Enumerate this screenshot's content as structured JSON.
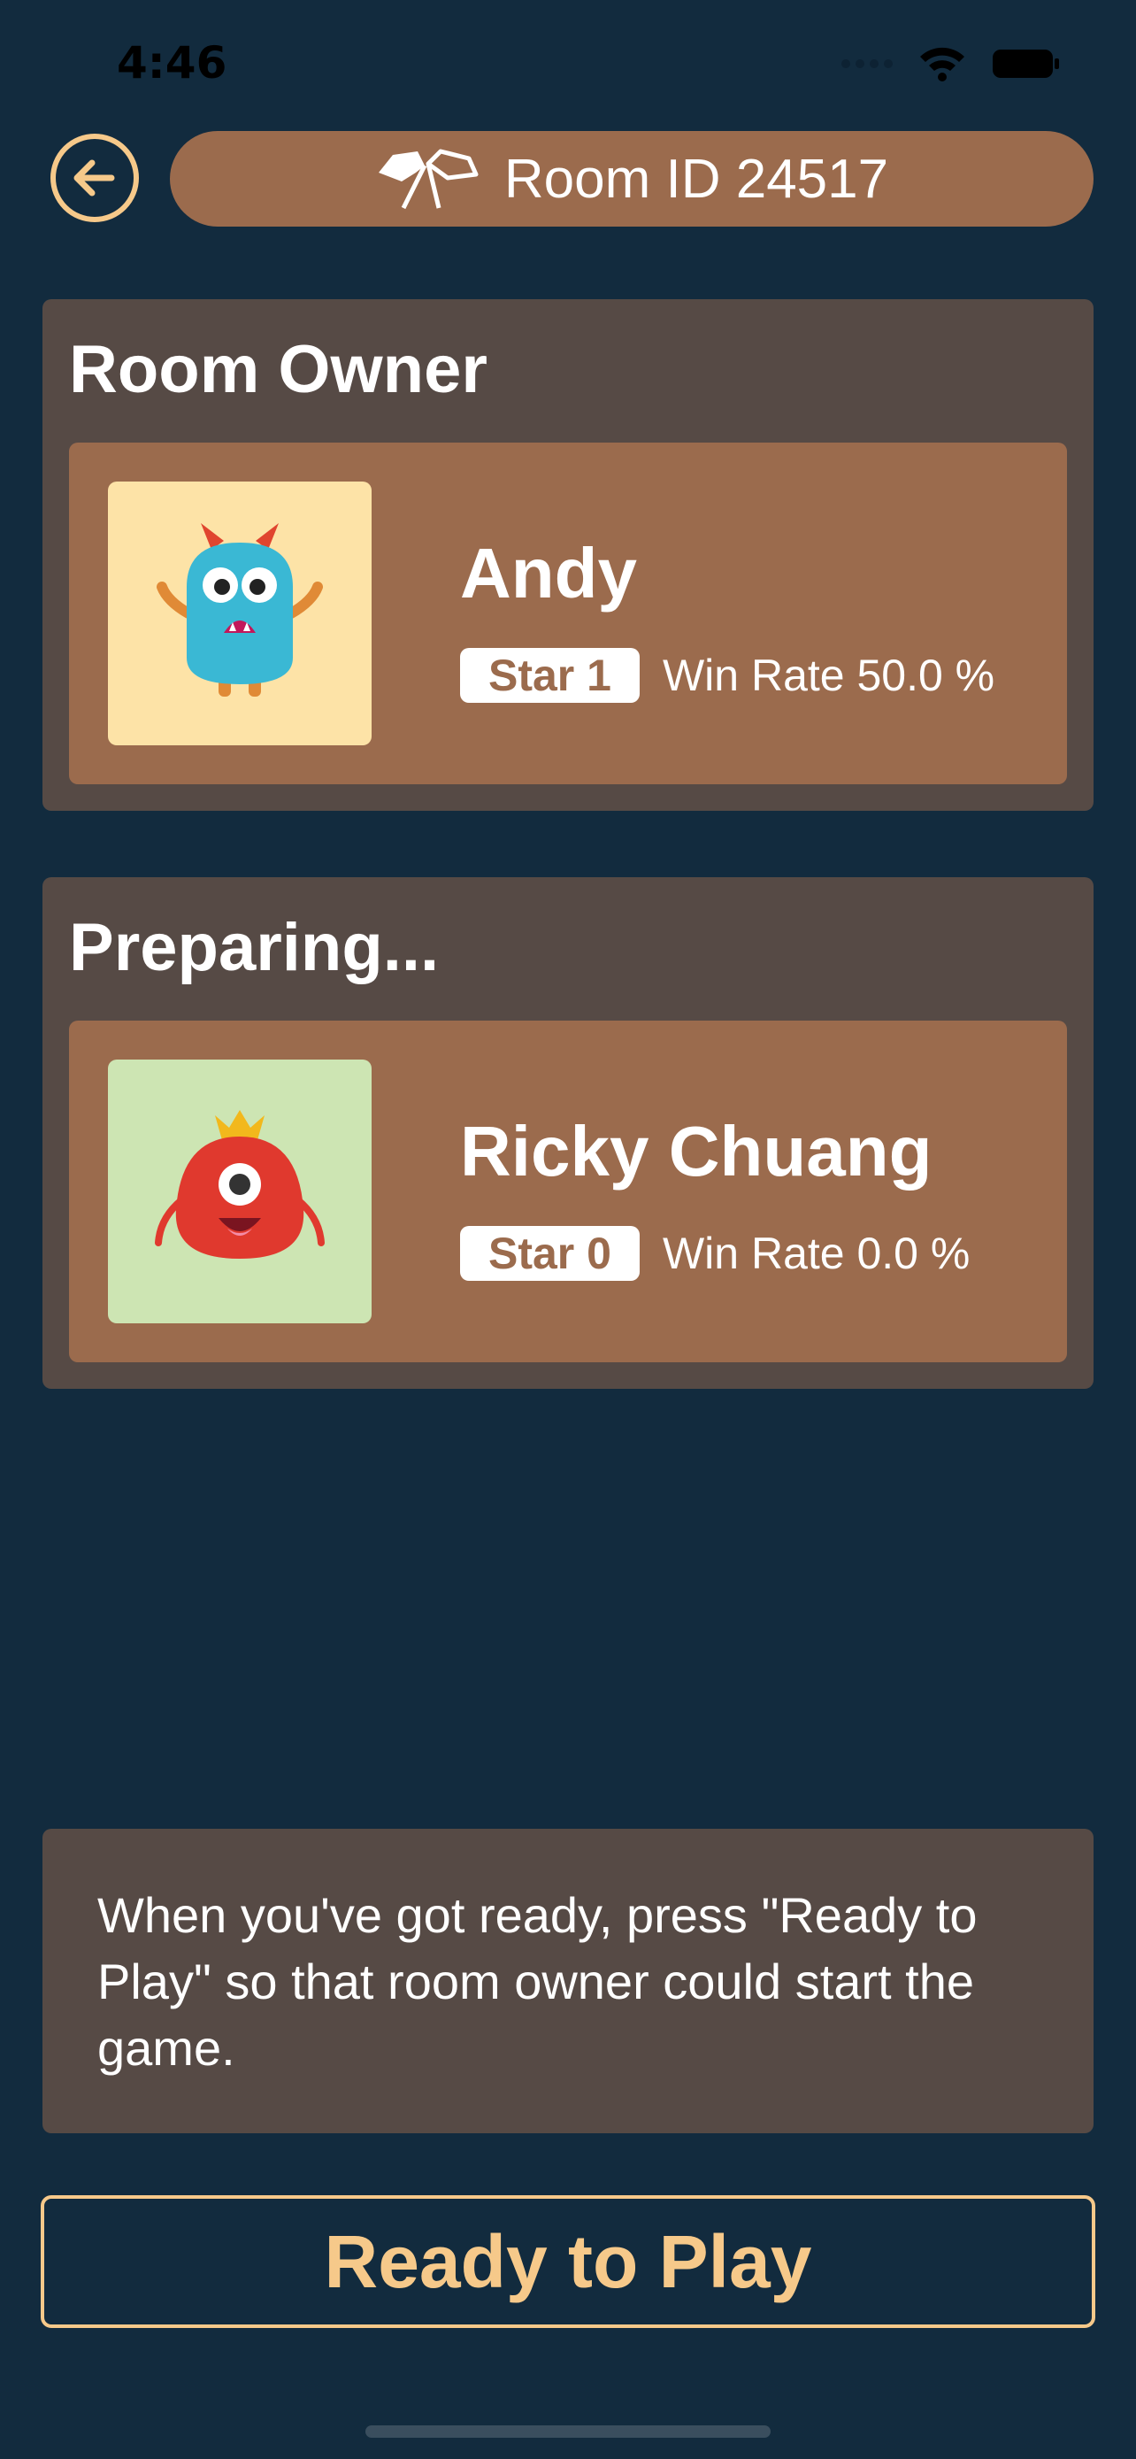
{
  "status_bar": {
    "time": "4:46"
  },
  "header": {
    "room_label": "Room ID 24517",
    "back_icon": "arrow-left-circle-icon",
    "flags_icon": "racing-flags-icon"
  },
  "owner_section": {
    "title": "Room Owner",
    "player": {
      "name": "Andy",
      "star": "Star 1",
      "win_rate": "Win Rate 50.0 %",
      "avatar_icon": "blue-monster-avatar",
      "avatar_bg": "#fde3a7"
    }
  },
  "guest_section": {
    "title": "Preparing...",
    "player": {
      "name": "Ricky Chuang",
      "star": "Star 0",
      "win_rate": "Win Rate 0.0 %",
      "avatar_icon": "red-monster-avatar",
      "avatar_bg": "#cde5b3"
    }
  },
  "info": {
    "text": "When you've got ready, press \"Ready to Play\" so that room owner could start the game."
  },
  "actions": {
    "ready_label": "Ready to Play"
  },
  "colors": {
    "background": "#122b3e",
    "card": "#564a45",
    "accent_brown": "#9b6b4d",
    "accent_gold": "#f6c98a"
  }
}
